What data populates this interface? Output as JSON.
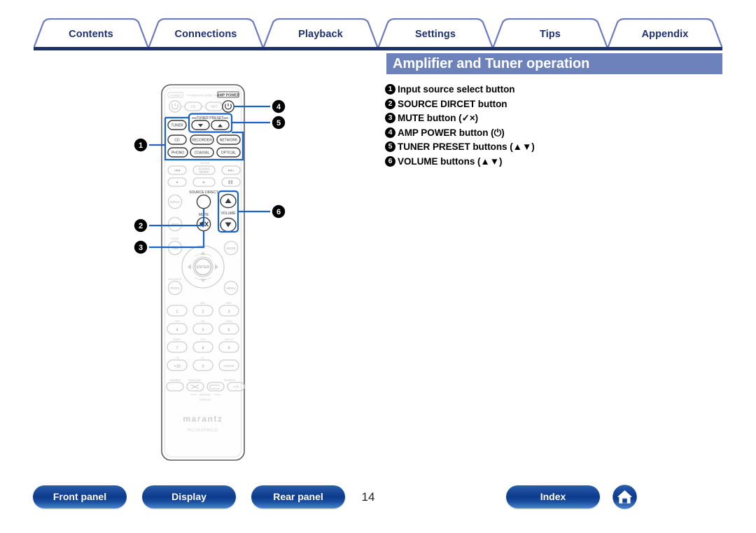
{
  "nav": {
    "tabs": [
      {
        "label": "Contents"
      },
      {
        "label": "Connections"
      },
      {
        "label": "Playback"
      },
      {
        "label": "Settings"
      },
      {
        "label": "Tips"
      },
      {
        "label": "Appendix"
      }
    ]
  },
  "header": {
    "title": "Amplifier and Tuner operation",
    "banner_color": "#6d82ba",
    "accent_color": "#1d3072"
  },
  "legend": {
    "items": [
      {
        "num": "1",
        "text": "Input source select button"
      },
      {
        "num": "2",
        "text": "SOURCE DIRCET button"
      },
      {
        "num": "3",
        "text": "MUTE button (✓×)"
      },
      {
        "num": "4",
        "text": "AMP POWER button (⏻)"
      },
      {
        "num": "5",
        "text": "TUNER PRESET buttons (▲▼)"
      },
      {
        "num": "6",
        "text": "VOLUME buttons (▲▼)"
      }
    ]
  },
  "remote": {
    "brand": "marantz",
    "model": "RC001PMCD",
    "labels": {
      "power": "POWER",
      "remote_mode": "REMOTE MODE",
      "amp_power": "AMP POWER",
      "tuner_preset": "TUNER PRESET",
      "m_dax": "M-DAX",
      "source_direct": "SOURCE DIRECT",
      "mute": "MUTE",
      "volume": "VOLUME",
      "home": "HOME",
      "favorite": "FAVORITE",
      "repeat": "REPEAT",
      "dimmer": "DIMMER",
      "random": "RANDOM",
      "search": "SEARCH",
      "display": "DISPLAY"
    },
    "buttons": {
      "mode_cd": "CD",
      "mode_net": "NET",
      "tuner": "TUNER",
      "source_cd": "CD",
      "recorder": "RECORDER",
      "network": "NETWORK",
      "phono": "PHONO",
      "coaxial": "COAXIAL",
      "optical": "OPTICAL",
      "sound_mode": "SOUND MODE",
      "input": "INPUT",
      "info": "INFO",
      "time": "TIME",
      "mode": "MODE",
      "enter": "ENTER",
      "prog": "PROG",
      "menu": "MENU",
      "clear": "CLEAR",
      "plus_ten": "+10",
      "ab": "A-B"
    },
    "keypad": [
      {
        "key": "1",
        "letters": ""
      },
      {
        "key": "2",
        "letters": "ABC"
      },
      {
        "key": "3",
        "letters": "DEF"
      },
      {
        "key": "4",
        "letters": "GHI"
      },
      {
        "key": "5",
        "letters": "JKL"
      },
      {
        "key": "6",
        "letters": "MNO"
      },
      {
        "key": "7",
        "letters": "PQRS"
      },
      {
        "key": "8",
        "letters": "TUV"
      },
      {
        "key": "9",
        "letters": "WXYZ"
      },
      {
        "key": "+10",
        "letters": "+10"
      },
      {
        "key": "0",
        "letters": "0-/"
      },
      {
        "key": "CLEAR",
        "letters": ""
      }
    ],
    "callouts": [
      "1",
      "2",
      "3",
      "4",
      "5",
      "6"
    ],
    "highlight_color": "#1b63c4"
  },
  "footer": {
    "front_panel": "Front panel",
    "display": "Display",
    "rear_panel": "Rear panel",
    "index": "Index",
    "page_number": "14",
    "home_icon": "home-icon"
  }
}
